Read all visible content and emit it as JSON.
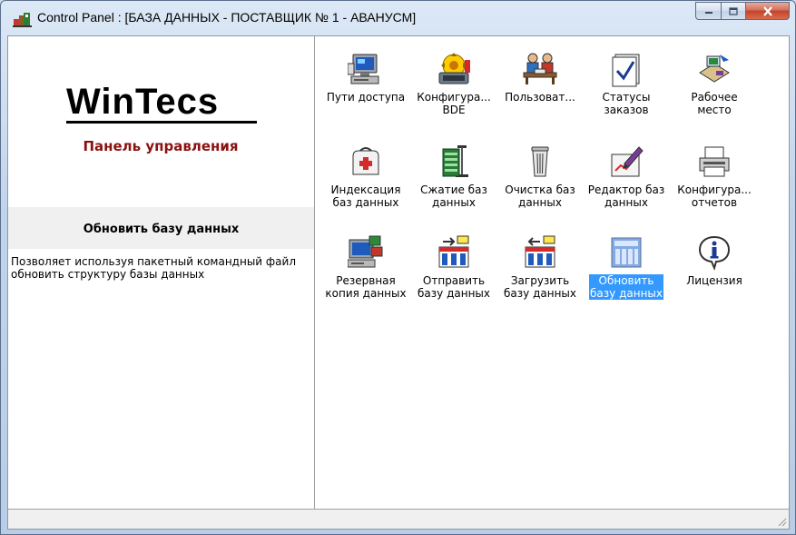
{
  "window": {
    "title": "Control Panel : [БАЗА ДАННЫХ - ПОСТАВЩИК № 1 - АВАНУСМ]"
  },
  "sidebar": {
    "logo_text": "WinTecs",
    "subtitle": "Панель управления",
    "section_title": "Обновить базу данных",
    "description": "Позволяет используя пакетный командный файл обновить структуру базы данных"
  },
  "items": [
    {
      "label": "Пути доступа",
      "icon": "computer-icon"
    },
    {
      "label": "Конфигура...\nBDE",
      "icon": "bde-gear-icon"
    },
    {
      "label": "Пользоват...",
      "icon": "users-icon"
    },
    {
      "label": "Статусы\nзаказов",
      "icon": "checkmark-status-icon"
    },
    {
      "label": "Рабочее\nместо",
      "icon": "workplace-icon"
    },
    {
      "label": "Индексация\nбаз данных",
      "icon": "first-aid-kit-icon"
    },
    {
      "label": "Сжатие баз\nданных",
      "icon": "compress-clamp-icon"
    },
    {
      "label": "Очистка баз\nданных",
      "icon": "trash-bin-icon"
    },
    {
      "label": "Редактор баз\nданных",
      "icon": "editor-pen-icon"
    },
    {
      "label": "Конфигура...\nотчетов",
      "icon": "printer-icon"
    },
    {
      "label": "Резервная\nкопия данных",
      "icon": "backup-computer-icon"
    },
    {
      "label": "Отправить\nбазу данных",
      "icon": "send-database-icon"
    },
    {
      "label": "Загрузить\nбазу данных",
      "icon": "load-database-icon"
    },
    {
      "label": "Обновить\nбазу данных",
      "icon": "update-database-icon",
      "selected": true
    },
    {
      "label": "Лицензия",
      "icon": "info-license-icon"
    }
  ],
  "colors": {
    "subtitle": "#8b1010",
    "selection": "#3399ff"
  }
}
